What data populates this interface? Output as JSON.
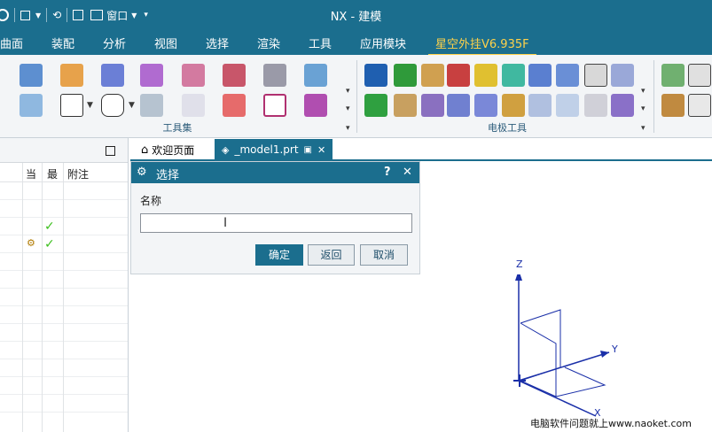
{
  "window": {
    "title": "NX - 建模",
    "quick_access_window": "窗口"
  },
  "menu": [
    "曲面",
    "装配",
    "分析",
    "视图",
    "选择",
    "渲染",
    "工具",
    "应用模块",
    "星空外挂V6.935F"
  ],
  "ribbon": {
    "group1_label": "工具集",
    "group2_label": "电极工具"
  },
  "navigator": {
    "columns": [
      "当",
      "最",
      "附注"
    ],
    "rows": [
      {
        "current": "",
        "latest": ""
      },
      {
        "current": "",
        "latest": ""
      },
      {
        "current": "",
        "latest": "✓"
      },
      {
        "current": "⚙",
        "latest": "✓"
      },
      {
        "current": "",
        "latest": ""
      },
      {
        "current": "",
        "latest": ""
      },
      {
        "current": "",
        "latest": ""
      },
      {
        "current": "",
        "latest": ""
      },
      {
        "current": "",
        "latest": ""
      },
      {
        "current": "",
        "latest": ""
      },
      {
        "current": "",
        "latest": ""
      },
      {
        "current": "",
        "latest": ""
      },
      {
        "current": "",
        "latest": ""
      }
    ]
  },
  "tabs": [
    {
      "label": "欢迎页面",
      "active": false
    },
    {
      "label": "_model1.prt",
      "active": true
    }
  ],
  "dialog": {
    "title": "选择",
    "field_label": "名称",
    "field_value": "",
    "ok": "确定",
    "back": "返回",
    "cancel": "取消",
    "help": "?",
    "close": "✕"
  },
  "axes": {
    "x": "X",
    "y": "Y",
    "z": "Z"
  },
  "watermark": "电脑软件问题就上www.naoket.com"
}
